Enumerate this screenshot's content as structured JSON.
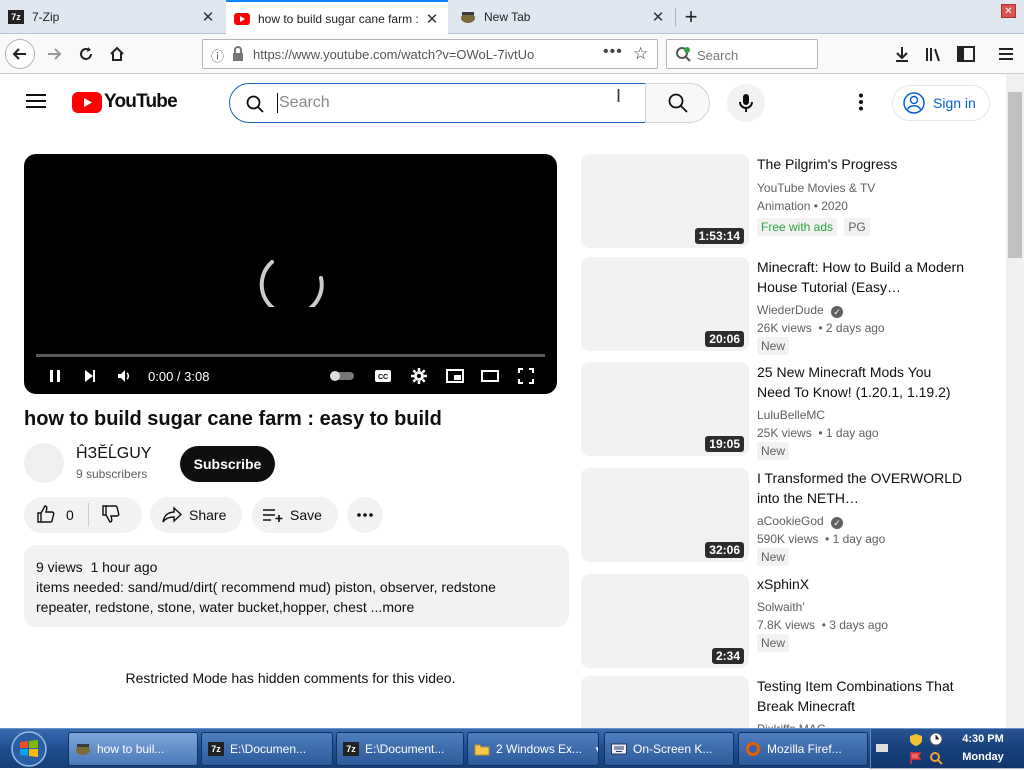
{
  "browser": {
    "tabs": [
      {
        "label": "7-Zip",
        "icon": "7zip-icon"
      },
      {
        "label": "how to build sugar cane farm :",
        "icon": "youtube-icon"
      },
      {
        "label": "New Tab",
        "icon": "newtab-icon"
      }
    ],
    "url": "https://www.youtube.com/watch?v=OWoL-7ivtUo",
    "search_placeholder": "Search"
  },
  "youtube": {
    "logo_text": "YouTube",
    "search_placeholder": "Search",
    "sign_in": "Sign in"
  },
  "video": {
    "time": "0:00 / 3:08",
    "title": "how to build sugar cane farm : easy to build",
    "channel": "ĤЗĔĹGUY",
    "subscribers": "9 subscribers",
    "subscribe": "Subscribe",
    "likes": "0",
    "share": "Share",
    "save": "Save",
    "views_time": "9 views  1 hour ago",
    "description": "items needed: sand/mud/dirt( recommend mud) piston, observer, redstone repeater, redstone, stone, water bucket,hopper, chest ...",
    "more": "more",
    "comments_notice": "Restricted Mode has hidden comments for this video."
  },
  "recommendations": [
    {
      "title": "The Pilgrim's Progress",
      "channel": "YouTube Movies & TV",
      "meta": "Animation • 2020",
      "free": "Free with ads",
      "rating": "PG",
      "duration": "1:53:14"
    },
    {
      "title": "Minecraft: How to Build a Modern House Tutorial (Easy…",
      "channel": "WiederDude",
      "meta": "26K views  • 2 days ago",
      "badge": "New",
      "duration": "20:06",
      "verified": true
    },
    {
      "title": "25 New Minecraft Mods You Need To Know! (1.20.1, 1.19.2)",
      "channel": "LuluBelleMC",
      "meta": "25K views  • 1 day ago",
      "badge": "New",
      "duration": "19:05"
    },
    {
      "title": "I Transformed the OVERWORLD into the NETH…",
      "channel": "aCookieGod",
      "meta": "590K views  • 1 day ago",
      "badge": "New",
      "duration": "32:06",
      "verified": true
    },
    {
      "title": "xSphinX",
      "channel": "Solwaith'",
      "meta": "7.8K views  • 3 days ago",
      "badge": "New",
      "duration": "2:34"
    },
    {
      "title": "Testing Item Combinations That Break Minecraft",
      "channel": "Pixlriffs MAC",
      "duration": ""
    }
  ],
  "taskbar": {
    "items": [
      {
        "label": "how to buil...",
        "icon": "firefox-icon"
      },
      {
        "label": "E:\\Documen...",
        "icon": "7zip-icon"
      },
      {
        "label": "E:\\Document...",
        "icon": "7zip-icon"
      },
      {
        "label": "2 Windows Ex...",
        "icon": "folder-icon"
      },
      {
        "label": "On-Screen K...",
        "icon": "keyboard-icon"
      },
      {
        "label": "Mozilla Firef...",
        "icon": "firefox-icon"
      }
    ],
    "time": "4:30 PM",
    "day": "Monday"
  },
  "colors": {
    "youtube_red": "#ff0000",
    "link_blue": "#065fd4",
    "free_green": "#2ba640",
    "taskbar_blue": "#1e4d8f"
  }
}
